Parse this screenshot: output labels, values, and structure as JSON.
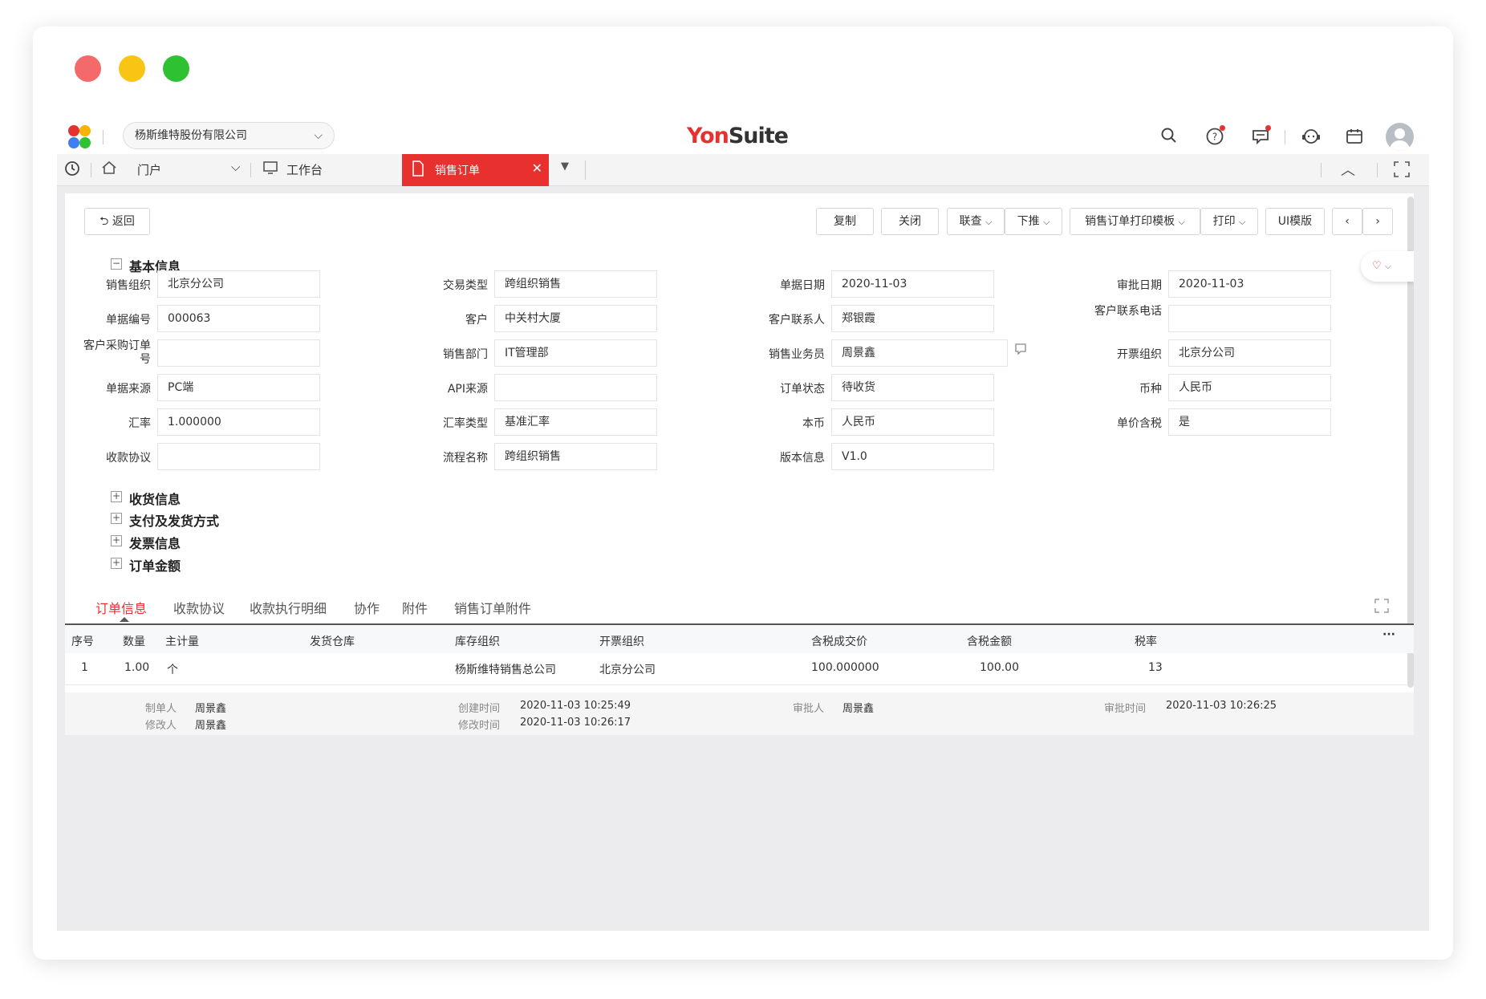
{
  "topbar": {
    "company": "杨斯维特股份有限公司",
    "brand_yon": "Yon",
    "brand_suite": "Suite"
  },
  "tabs": {
    "portal": "门户",
    "workbench": "工作台",
    "active": "销售订单"
  },
  "toolbar": {
    "back": "返回",
    "copy": "复制",
    "close": "关闭",
    "linked_query": "联查",
    "push_down": "下推",
    "print_template": "销售订单打印模板",
    "print": "打印",
    "ui_template": "UI模版"
  },
  "sections": {
    "basic": "基本信息",
    "receiving": "收货信息",
    "payment_shipping": "支付及发货方式",
    "invoice": "发票信息",
    "amount": "订单金额"
  },
  "fields": [
    {
      "label": "销售组织",
      "value": "北京分公司"
    },
    {
      "label": "交易类型",
      "value": "跨组织销售"
    },
    {
      "label": "单据日期",
      "value": "2020-11-03"
    },
    {
      "label": "审批日期",
      "value": "2020-11-03"
    },
    {
      "label": "单据编号",
      "value": "000063"
    },
    {
      "label": "客户",
      "value": "中关村大厦"
    },
    {
      "label": "客户联系人",
      "value": "郑银霞"
    },
    {
      "label": "客户联系电话",
      "value": ""
    },
    {
      "label": "客户采购订单号",
      "value": ""
    },
    {
      "label": "销售部门",
      "value": "IT管理部"
    },
    {
      "label": "销售业务员",
      "value": "周景鑫"
    },
    {
      "label": "开票组织",
      "value": "北京分公司"
    },
    {
      "label": "单据来源",
      "value": "PC端"
    },
    {
      "label": "API来源",
      "value": ""
    },
    {
      "label": "订单状态",
      "value": "待收货"
    },
    {
      "label": "币种",
      "value": "人民币"
    },
    {
      "label": "汇率",
      "value": "1.000000"
    },
    {
      "label": "汇率类型",
      "value": "基准汇率"
    },
    {
      "label": "本币",
      "value": "人民币"
    },
    {
      "label": "单价含税",
      "value": "是"
    },
    {
      "label": "收款协议",
      "value": ""
    },
    {
      "label": "流程名称",
      "value": "跨组织销售"
    },
    {
      "label": "版本信息",
      "value": "V1.0"
    }
  ],
  "subtabs": [
    "订单信息",
    "收款协议",
    "收款执行明细",
    "协作",
    "附件",
    "销售订单附件"
  ],
  "table": {
    "headers": [
      "序号",
      "数量",
      "主计量",
      "发货仓库",
      "库存组织",
      "开票组织",
      "含税成交价",
      "含税金额",
      "税率"
    ],
    "row": [
      "1",
      "1.00",
      "个",
      "",
      "杨斯维特销售总公司",
      "北京分公司",
      "100.000000",
      "100.00",
      "13"
    ]
  },
  "footer": {
    "creator_label": "制单人",
    "creator": "周景鑫",
    "modifier_label": "修改人",
    "modifier": "周景鑫",
    "created_label": "创建时间",
    "created": "2020-11-03 10:25:49",
    "modified_label": "修改时间",
    "modified": "2020-11-03 10:26:17",
    "approver_label": "审批人",
    "approver": "周景鑫",
    "approved_label": "审批时间",
    "approved": "2020-11-03 10:26:25"
  }
}
